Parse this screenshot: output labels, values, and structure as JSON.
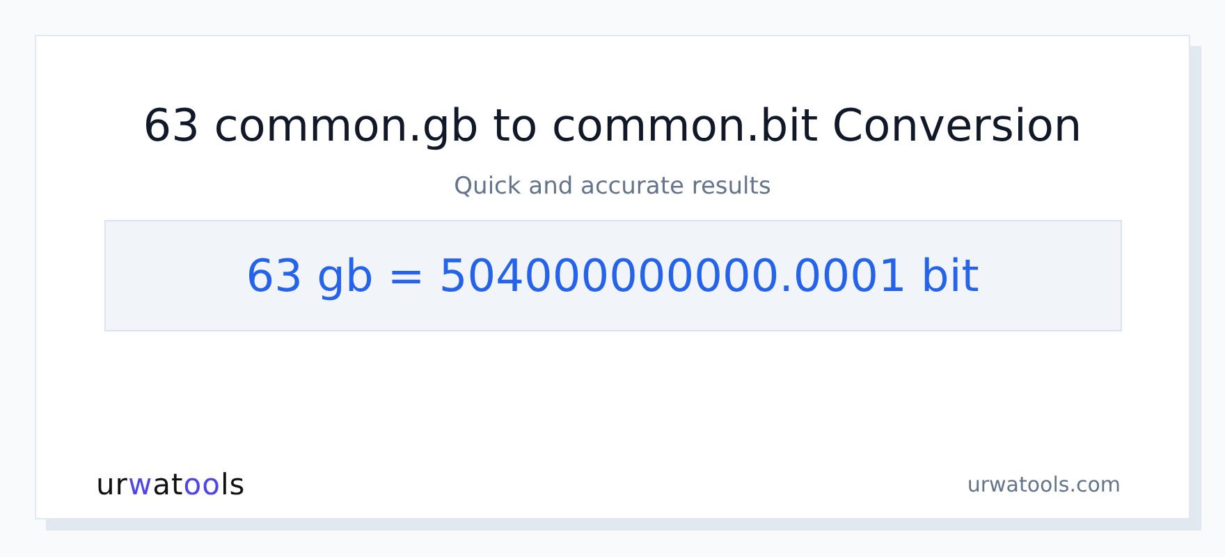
{
  "title": "63 common.gb to common.bit Conversion",
  "subtitle": "Quick and accurate results",
  "result": "63 gb = 504000000000.0001 bit",
  "logo": [
    {
      "text": "ur",
      "kind": "plain"
    },
    {
      "text": "w",
      "kind": "accent"
    },
    {
      "text": "at",
      "kind": "plain"
    },
    {
      "text": "oo",
      "kind": "accent"
    },
    {
      "text": "ls",
      "kind": "plain"
    }
  ],
  "site": "urwatools.com"
}
